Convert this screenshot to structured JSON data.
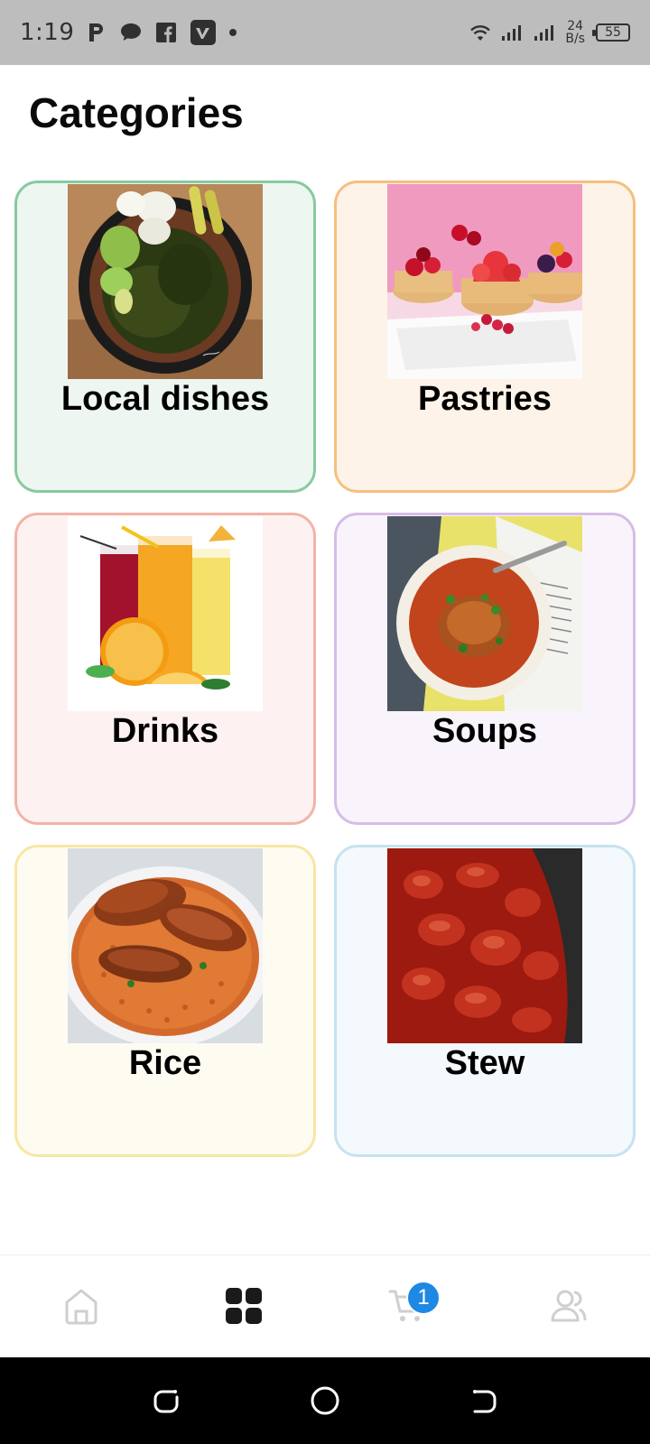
{
  "status_bar": {
    "time": "1:19",
    "icons": [
      "parking-p-icon",
      "chat-bubble-icon",
      "facebook-icon",
      "vimeo-icon",
      "notification-dot-icon",
      "wifi-icon",
      "signal-icon",
      "signal-icon"
    ],
    "net_speed_value": "24",
    "net_speed_unit": "B/s",
    "battery": "55"
  },
  "page": {
    "title": "Categories"
  },
  "categories": [
    {
      "label": "Local dishes",
      "border": "#88c9a0",
      "bg": "#eef6f1",
      "image": "local-dishes-photo"
    },
    {
      "label": "Pastries",
      "border": "#f6bf80",
      "bg": "#fdf3e8",
      "image": "pastries-photo"
    },
    {
      "label": "Drinks",
      "border": "#f3b3a8",
      "bg": "#fdf2f1",
      "image": "drinks-photo"
    },
    {
      "label": "Soups",
      "border": "#d7bde6",
      "bg": "#f9f4fb",
      "image": "soups-photo"
    },
    {
      "label": "Rice",
      "border": "#f8e6a5",
      "bg": "#fefbf1",
      "image": "rice-photo"
    },
    {
      "label": "Stew",
      "border": "#c5e3f0",
      "bg": "#f4f9fd",
      "image": "stew-photo"
    }
  ],
  "bottom_nav": {
    "items": [
      "home-icon",
      "grid-icon",
      "cart-icon",
      "profile-icon"
    ],
    "active": "grid-icon",
    "cart_badge": "1",
    "badge_color": "#1e88e5"
  },
  "system_nav": {
    "items": [
      "recent-apps-icon",
      "home-circle-icon",
      "back-icon"
    ]
  }
}
